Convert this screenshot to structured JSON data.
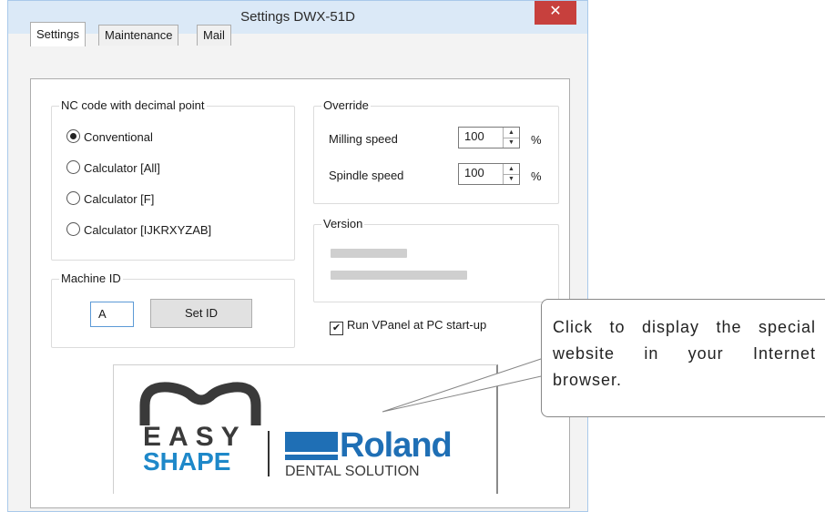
{
  "window": {
    "title": "Settings DWX-51D",
    "close_glyph": "✕"
  },
  "tabs": [
    {
      "label": "Settings",
      "active": true
    },
    {
      "label": "Maintenance",
      "active": false
    },
    {
      "label": "Mail",
      "active": false
    }
  ],
  "nc_code": {
    "legend": "NC code with decimal point",
    "options": [
      {
        "label": "Conventional",
        "checked": true
      },
      {
        "label": "Calculator [All]",
        "checked": false
      },
      {
        "label": "Calculator [F]",
        "checked": false
      },
      {
        "label": "Calculator [IJKRXYZAB]",
        "checked": false
      }
    ]
  },
  "override": {
    "legend": "Override",
    "milling_label": "Milling speed",
    "milling_value": "100",
    "spindle_label": "Spindle speed",
    "spindle_value": "100",
    "unit": "%"
  },
  "version": {
    "legend": "Version"
  },
  "machine_id": {
    "legend": "Machine ID",
    "value": "A",
    "set_button": "Set ID"
  },
  "run_vpanel": {
    "label": "Run VPanel at PC start-up",
    "checked": true
  },
  "callout": {
    "text": "Click to display the special website in your Internet browser."
  },
  "logo": {
    "easy_line1": "EASY",
    "easy_line2": "SHAPE",
    "roland": "Roland",
    "dental": "DENTAL SOLUTION"
  },
  "colors": {
    "accent_blue": "#1f6fb5",
    "easy_shape_blue": "#1e88c9",
    "close_red": "#c7403d",
    "titlebar": "#dbe9f7"
  }
}
